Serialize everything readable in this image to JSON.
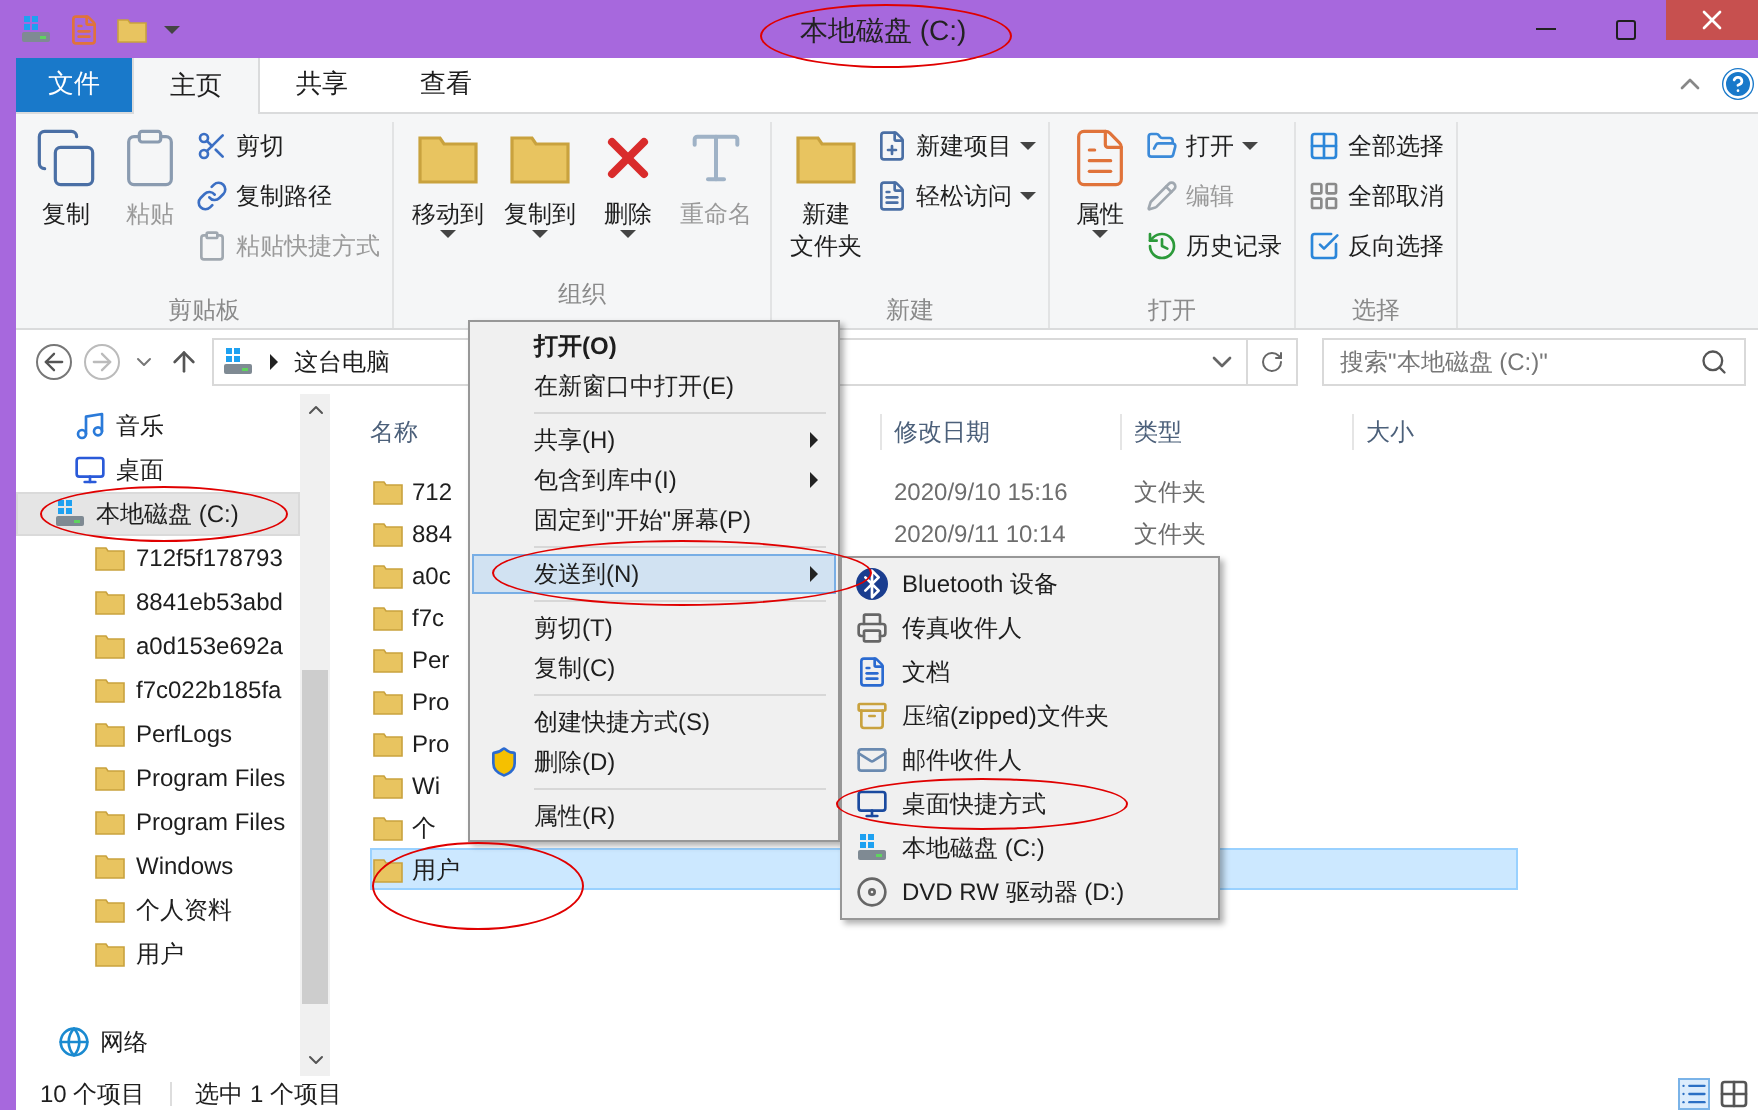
{
  "window": {
    "title": "本地磁盘 (C:)"
  },
  "ribbon_tabs": [
    {
      "label": "文件",
      "kind": "file",
      "selected": false
    },
    {
      "label": "主页",
      "kind": "tab",
      "selected": true
    },
    {
      "label": "共享",
      "kind": "tab",
      "selected": false
    },
    {
      "label": "查看",
      "kind": "tab",
      "selected": false
    }
  ],
  "ribbon_groups": [
    {
      "label": "剪贴板",
      "large": [
        {
          "label_lines": [
            "复制"
          ],
          "disabled": false,
          "has_menu": false
        },
        {
          "label_lines": [
            "粘贴"
          ],
          "disabled": true,
          "has_menu": false
        }
      ],
      "small": [
        {
          "label": "剪切",
          "disabled": false,
          "has_menu": false
        },
        {
          "label": "复制路径",
          "disabled": false,
          "has_menu": false
        },
        {
          "label": "粘贴快捷方式",
          "disabled": true,
          "has_menu": false
        }
      ]
    },
    {
      "label": "组织",
      "large": [
        {
          "label_lines": [
            "移动到"
          ],
          "disabled": false,
          "has_menu": true
        },
        {
          "label_lines": [
            "复制到"
          ],
          "disabled": false,
          "has_menu": true
        },
        {
          "label_lines": [
            "删除"
          ],
          "disabled": false,
          "has_menu": true
        },
        {
          "label_lines": [
            "重命名"
          ],
          "disabled": true,
          "has_menu": false
        }
      ]
    },
    {
      "label": "新建",
      "large": [
        {
          "label_lines": [
            "新建",
            "文件夹"
          ],
          "disabled": false,
          "has_menu": false
        }
      ],
      "small": [
        {
          "label": "新建项目",
          "disabled": false,
          "has_menu": true
        },
        {
          "label": "轻松访问",
          "disabled": false,
          "has_menu": true
        }
      ]
    },
    {
      "label": "打开",
      "large": [
        {
          "label_lines": [
            "属性"
          ],
          "disabled": false,
          "has_menu": true
        }
      ],
      "small": [
        {
          "label": "打开",
          "disabled": false,
          "has_menu": true
        },
        {
          "label": "编辑",
          "disabled": true,
          "has_menu": false
        },
        {
          "label": "历史记录",
          "disabled": false,
          "has_menu": false
        }
      ]
    },
    {
      "label": "选择",
      "small": [
        {
          "label": "全部选择",
          "disabled": false,
          "has_menu": false
        },
        {
          "label": "全部取消",
          "disabled": false,
          "has_menu": false
        },
        {
          "label": "反向选择",
          "disabled": false,
          "has_menu": false
        }
      ]
    }
  ],
  "address": {
    "breadcrumb": [
      "这台电脑"
    ],
    "search_placeholder": "搜索\"本地磁盘 (C:)\""
  },
  "nav_pane": [
    {
      "label": "音乐",
      "kind": "music",
      "selected": false
    },
    {
      "label": "桌面",
      "kind": "desktop",
      "selected": false
    },
    {
      "label": "本地磁盘 (C:)",
      "kind": "drive",
      "selected": true,
      "children": [
        {
          "label": "712f5f178793",
          "kind": "folder",
          "selected": false
        },
        {
          "label": "8841eb53abd",
          "kind": "folder",
          "selected": false
        },
        {
          "label": "a0d153e692a",
          "kind": "folder",
          "selected": false
        },
        {
          "label": "f7c022b185fa",
          "kind": "folder",
          "selected": false
        },
        {
          "label": "PerfLogs",
          "kind": "folder",
          "selected": false
        },
        {
          "label": "Program Files",
          "kind": "folder",
          "selected": false
        },
        {
          "label": "Program Files",
          "kind": "folder",
          "selected": false
        },
        {
          "label": "Windows",
          "kind": "folder",
          "selected": false
        },
        {
          "label": "个人资料",
          "kind": "folder",
          "selected": false
        },
        {
          "label": "用户",
          "kind": "folder",
          "selected": false
        }
      ]
    },
    {
      "label": "网络",
      "kind": "network",
      "selected": false
    }
  ],
  "file_list": {
    "columns": [
      "名称",
      "修改日期",
      "类型",
      "大小"
    ],
    "rows": [
      {
        "name": "712",
        "date": "2020/9/10 15:16",
        "type": "文件夹",
        "selected": false
      },
      {
        "name": "884",
        "date": "2020/9/11 10:14",
        "type": "文件夹",
        "selected": false
      },
      {
        "name": "a0c",
        "selected": false
      },
      {
        "name": "f7c",
        "selected": false
      },
      {
        "name": "Per",
        "selected": false
      },
      {
        "name": "Pro",
        "selected": false
      },
      {
        "name": "Pro",
        "selected": false
      },
      {
        "name": "Wi",
        "selected": false
      },
      {
        "name": "个",
        "selected": false
      },
      {
        "name": "用户",
        "selected": true
      }
    ]
  },
  "context_menu": {
    "items": [
      {
        "label": "打开(O)",
        "kind": "default",
        "has_submenu": false,
        "selected": false
      },
      {
        "label": "在新窗口中打开(E)",
        "kind": "item",
        "has_submenu": false,
        "selected": false
      },
      {
        "kind": "separator"
      },
      {
        "label": "共享(H)",
        "kind": "item",
        "has_submenu": true,
        "selected": false
      },
      {
        "label": "包含到库中(I)",
        "kind": "item",
        "has_submenu": true,
        "selected": false
      },
      {
        "label": "固定到\"开始\"屏幕(P)",
        "kind": "item",
        "has_submenu": false,
        "selected": false
      },
      {
        "kind": "separator"
      },
      {
        "label": "发送到(N)",
        "kind": "item",
        "has_submenu": true,
        "selected": true
      },
      {
        "kind": "separator"
      },
      {
        "label": "剪切(T)",
        "kind": "item",
        "has_submenu": false,
        "selected": false
      },
      {
        "label": "复制(C)",
        "kind": "item",
        "has_submenu": false,
        "selected": false
      },
      {
        "kind": "separator"
      },
      {
        "label": "创建快捷方式(S)",
        "kind": "item",
        "has_submenu": false,
        "selected": false
      },
      {
        "label": "删除(D)",
        "kind": "admin",
        "has_submenu": false,
        "selected": false
      },
      {
        "kind": "separator"
      },
      {
        "label": "属性(R)",
        "kind": "item",
        "has_submenu": false,
        "selected": false
      }
    ]
  },
  "send_to_menu": {
    "items": [
      {
        "label": "Bluetooth 设备",
        "kind": "bluetooth"
      },
      {
        "label": "传真收件人",
        "kind": "fax"
      },
      {
        "label": "文档",
        "kind": "document"
      },
      {
        "label": "压缩(zipped)文件夹",
        "kind": "zip"
      },
      {
        "label": "邮件收件人",
        "kind": "mail"
      },
      {
        "label": "桌面快捷方式",
        "kind": "desktop"
      },
      {
        "label": "本地磁盘 (C:)",
        "kind": "drive"
      },
      {
        "label": "DVD RW 驱动器 (D:)",
        "kind": "dvd"
      }
    ]
  },
  "status_bar": {
    "count": "10 个项目",
    "selection": "选中 1 个项目"
  }
}
